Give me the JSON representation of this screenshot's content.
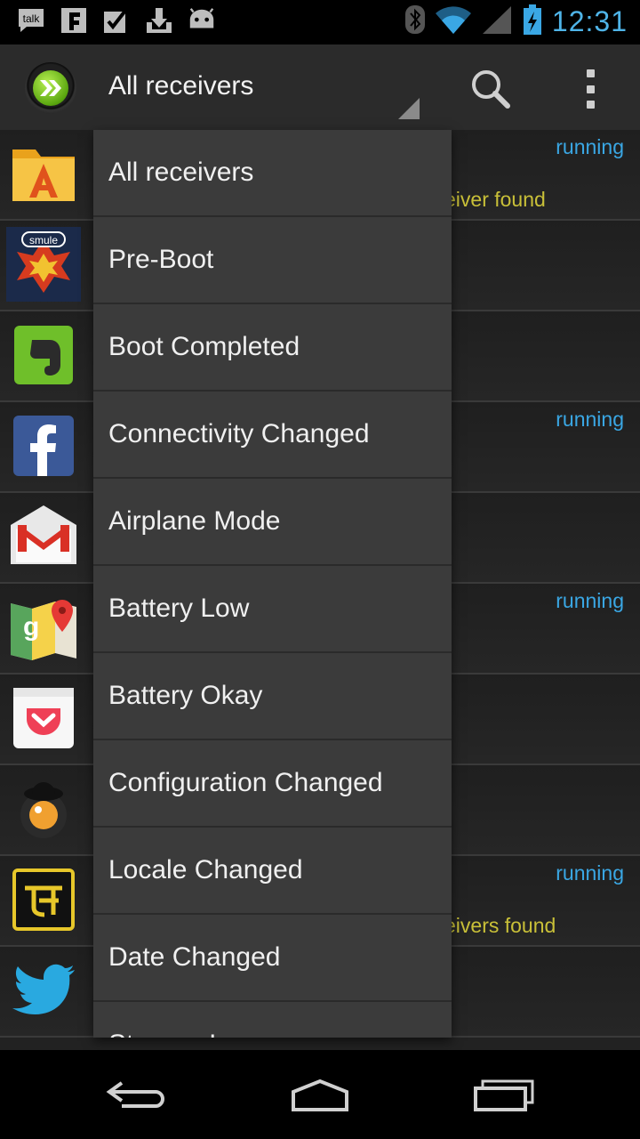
{
  "statusbar": {
    "left_icons": [
      "talk-icon",
      "flipboard-icon",
      "checkbox-icon",
      "download-icon",
      "android-icon"
    ],
    "talk_label": "talk",
    "clock": "12:31"
  },
  "actionbar": {
    "spinner_selected": "All receivers"
  },
  "dropdown": {
    "items": [
      "All receivers",
      "Pre-Boot",
      "Boot Completed",
      "Connectivity Changed",
      "Airplane Mode",
      "Battery Low",
      "Battery Okay",
      "Configuration Changed",
      "Locale Changed",
      "Date Changed",
      "Storage Low"
    ]
  },
  "list": {
    "rows": [
      {
        "icon": "astro-file-manager-icon",
        "status": "running",
        "found": "eiver found"
      },
      {
        "icon": "smule-icon",
        "status": "",
        "found": ""
      },
      {
        "icon": "evernote-icon",
        "status": "",
        "found": ""
      },
      {
        "icon": "facebook-icon",
        "status": "running",
        "found": ""
      },
      {
        "icon": "gmail-icon",
        "status": "",
        "found": ""
      },
      {
        "icon": "google-maps-icon",
        "status": "running",
        "found": ""
      },
      {
        "icon": "pocket-icon",
        "status": "",
        "found": ""
      },
      {
        "icon": "clockwork-icon",
        "status": "",
        "found": ""
      },
      {
        "icon": "translator-icon",
        "status": "running",
        "found": "eivers found"
      },
      {
        "icon": "twitter-icon",
        "status": "",
        "found": ""
      }
    ]
  },
  "colors": {
    "accent_blue": "#3aa7e4",
    "found_yellow": "#c9c038",
    "actionbar_bg": "#2b2b2b",
    "dropdown_bg": "#3b3b3b"
  }
}
